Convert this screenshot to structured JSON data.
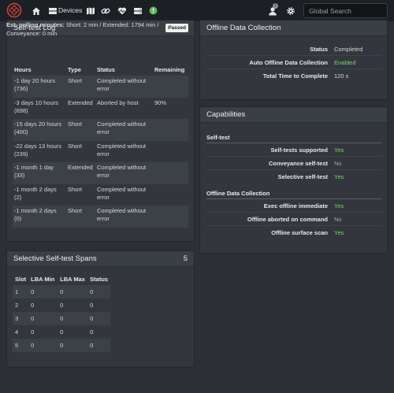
{
  "nav": {
    "devices_label": "Devices",
    "notification_count": "1",
    "search_placeholder": "Global Search"
  },
  "selftest_log": {
    "title": "Self-test Log",
    "status_badge": "Passed",
    "est_label": "Est. polling minutes:",
    "est_value": " Short: 2 min / Extended: 1794 min / Conveyance: 0 min",
    "columns": [
      "Hours",
      "Type",
      "Status",
      "Remaining"
    ],
    "rows": [
      {
        "hours": "-1 day 20 hours (736)",
        "type": "Short",
        "status": "Completed without error",
        "remaining": ""
      },
      {
        "hours": "-3 days 10 hours (698)",
        "type": "Extended",
        "status": "Aborted by host",
        "remaining": "90%"
      },
      {
        "hours": "-15 days 20 hours (400)",
        "type": "Short",
        "status": "Completed without error",
        "remaining": ""
      },
      {
        "hours": "-22 days 13 hours (239)",
        "type": "Short",
        "status": "Completed without error",
        "remaining": ""
      },
      {
        "hours": "-1 month 1 day (33)",
        "type": "Extended",
        "status": "Completed without error",
        "remaining": ""
      },
      {
        "hours": "-1 month 2 days (2)",
        "type": "Short",
        "status": "Completed without error",
        "remaining": ""
      },
      {
        "hours": "-1 month 2 days (0)",
        "type": "Short",
        "status": "Completed without error",
        "remaining": ""
      }
    ]
  },
  "selective_spans": {
    "title": "Selective Self-test Spans",
    "count": "5",
    "columns": [
      "Slot",
      "LBA Min",
      "LBA Max",
      "Status"
    ],
    "rows": [
      [
        "1",
        "0",
        "0",
        "0"
      ],
      [
        "2",
        "0",
        "0",
        "0"
      ],
      [
        "3",
        "0",
        "0",
        "0"
      ],
      [
        "4",
        "0",
        "0",
        "0"
      ],
      [
        "5",
        "0",
        "0",
        "0"
      ]
    ]
  },
  "offline_collection": {
    "title": "Offline Data Collection",
    "rows": [
      {
        "key": "Status",
        "value": "Completed"
      },
      {
        "key": "Auto Offline Data Collection",
        "value": "Enabled"
      },
      {
        "key": "Total Time to Complete",
        "value": "120 s"
      }
    ]
  },
  "capabilities": {
    "title": "Capabilities",
    "selftest_section": "Self-test",
    "selftest_rows": [
      {
        "key": "Self-tests supported",
        "value": "Yes"
      },
      {
        "key": "Conveyance self-test",
        "value": "No"
      },
      {
        "key": "Selective self-test",
        "value": "Yes"
      }
    ],
    "offline_section": "Offline Data Collection",
    "offline_rows": [
      {
        "key": "Exec offline immediate",
        "value": "Yes"
      },
      {
        "key": "Offline aborted on command",
        "value": "No"
      },
      {
        "key": "Offline surface scan",
        "value": "Yes"
      }
    ]
  },
  "colors": {
    "positive": "#7bd36f",
    "negative": "#a0a4aa",
    "topbar": "#1c1f23",
    "panel": "#33373d"
  },
  "icons": [
    "app-logo-icon",
    "home-icon",
    "devices-icon",
    "map-icon",
    "link-icon",
    "health-icon",
    "storage-icon",
    "status-ok-icon",
    "user-icon",
    "gear-icon"
  ]
}
